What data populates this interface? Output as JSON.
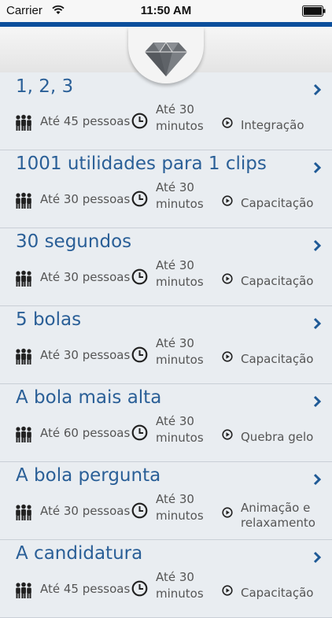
{
  "status_bar": {
    "carrier": "Carrier",
    "time": "11:50 AM"
  },
  "header": {
    "logo_icon": "diamond-icon"
  },
  "colors": {
    "accent_blue": "#0b4f9c",
    "title_blue": "#2a5f97",
    "background": "#e8ecf0"
  },
  "items": [
    {
      "title": "1, 2, 3",
      "people": "Até 45 pessoas",
      "time_line1": "Até 30",
      "time_line2": "minutos",
      "category_line1": "Integração",
      "category_line2": ""
    },
    {
      "title": "1001 utilidades para 1 clips",
      "people": "Até 30 pessoas",
      "time_line1": "Até 30",
      "time_line2": "minutos",
      "category_line1": "Capacitação",
      "category_line2": ""
    },
    {
      "title": "30 segundos",
      "people": "Até 30 pessoas",
      "time_line1": "Até 30",
      "time_line2": "minutos",
      "category_line1": "Capacitação",
      "category_line2": ""
    },
    {
      "title": "5 bolas",
      "people": "Até 30 pessoas",
      "time_line1": "Até 30",
      "time_line2": "minutos",
      "category_line1": "Capacitação",
      "category_line2": ""
    },
    {
      "title": "A bola mais alta",
      "people": "Até 60 pessoas",
      "time_line1": "Até 30",
      "time_line2": "minutos",
      "category_line1": "Quebra gelo",
      "category_line2": ""
    },
    {
      "title": "A bola pergunta",
      "people": "Até 30 pessoas",
      "time_line1": "Até 30",
      "time_line2": "minutos",
      "category_line1": "Animação e",
      "category_line2": "relaxamento"
    },
    {
      "title": "A candidatura",
      "people": "Até 45 pessoas",
      "time_line1": "Até 30",
      "time_line2": "minutos",
      "category_line1": "Capacitação",
      "category_line2": ""
    }
  ]
}
